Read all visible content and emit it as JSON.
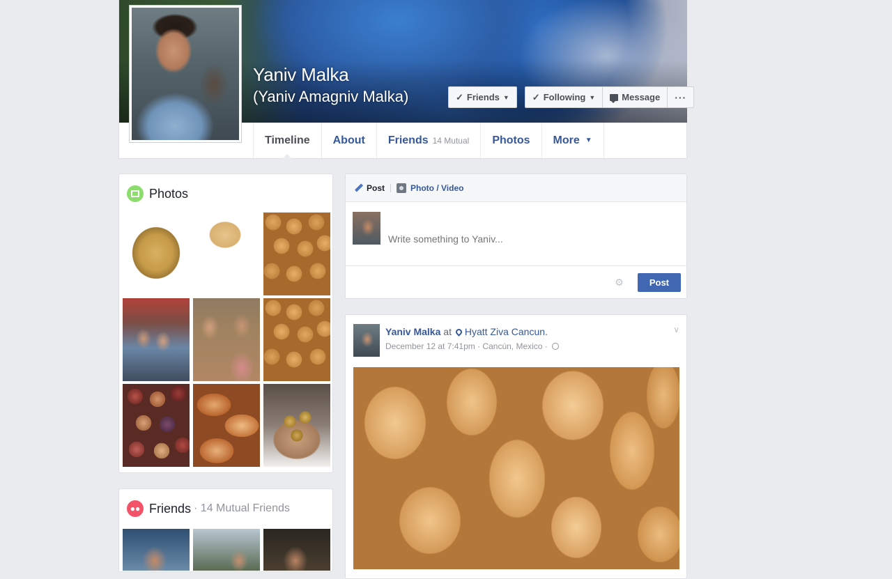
{
  "profile": {
    "name": "Yaniv Malka",
    "alternate_name": "(Yaniv Amagniv Malka)",
    "actions": {
      "friends_label": "Friends",
      "following_label": "Following",
      "message_label": "Message",
      "more_label": "···"
    }
  },
  "tabs": [
    {
      "label": "Timeline",
      "active": true
    },
    {
      "label": "About"
    },
    {
      "label": "Friends",
      "sub": "14 Mutual"
    },
    {
      "label": "Photos"
    },
    {
      "label": "More"
    }
  ],
  "photos_card": {
    "title": "Photos",
    "photos": [
      "potato",
      "peeled-potato",
      "potatoes-pile",
      "group-photo",
      "selfie-photo",
      "potatoes-pile",
      "red-potatoes",
      "roasted-potatoes",
      "potatoes-in-hands"
    ]
  },
  "friends_card": {
    "title": "Friends",
    "subtitle": "· 14 Mutual Friends"
  },
  "composer": {
    "post_tab": "Post",
    "photo_tab": "Photo / Video",
    "placeholder": "Write something to Yaniv...",
    "post_button": "Post"
  },
  "feed_post": {
    "author": "Yaniv Malka",
    "at": "at",
    "place": "Hyatt Ziva Cancun.",
    "timestamp": "December 12 at 7:41pm",
    "location": "· Cancún, Mexico ·"
  },
  "icons": {
    "check": "✓",
    "caret": "▼",
    "gear": "⚙",
    "chevron": "∨",
    "friends_glyph": "👥"
  }
}
